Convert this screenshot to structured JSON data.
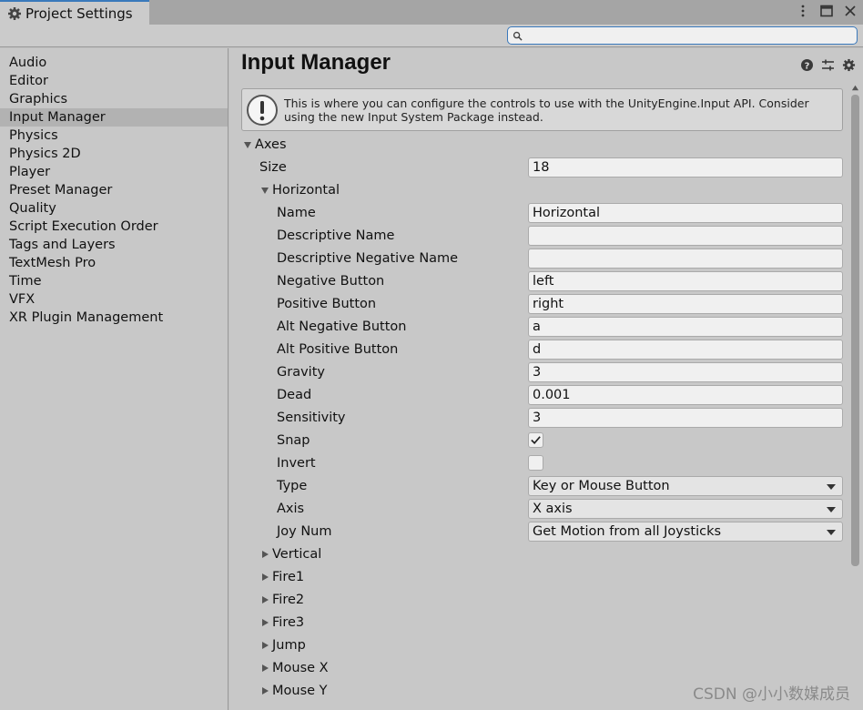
{
  "window": {
    "tab_label": "Project Settings",
    "tab_icon": "gear-icon",
    "controls": [
      "menu-dots-icon",
      "maximize-icon",
      "close-icon"
    ]
  },
  "search": {
    "placeholder": "",
    "value": ""
  },
  "sidebar": {
    "selected": "Input Manager",
    "items": [
      {
        "label": "Audio"
      },
      {
        "label": "Editor"
      },
      {
        "label": "Graphics"
      },
      {
        "label": "Input Manager"
      },
      {
        "label": "Physics"
      },
      {
        "label": "Physics 2D"
      },
      {
        "label": "Player"
      },
      {
        "label": "Preset Manager"
      },
      {
        "label": "Quality"
      },
      {
        "label": "Script Execution Order"
      },
      {
        "label": "Tags and Layers"
      },
      {
        "label": "TextMesh Pro"
      },
      {
        "label": "Time"
      },
      {
        "label": "VFX"
      },
      {
        "label": "XR Plugin Management"
      }
    ]
  },
  "main": {
    "title": "Input Manager",
    "header_icons": [
      "help-icon",
      "presets-icon",
      "settings-gear-icon"
    ],
    "help_text": "This is where you can configure the controls to use with the UnityEngine.Input API. Consider using the new Input System Package instead.",
    "axes_label": "Axes",
    "size_label": "Size",
    "size_value": "18",
    "horizontal_label": "Horizontal",
    "props": {
      "name": {
        "label": "Name",
        "value": "Horizontal"
      },
      "descriptive_name": {
        "label": "Descriptive Name",
        "value": ""
      },
      "descriptive_negative_name": {
        "label": "Descriptive Negative Name",
        "value": ""
      },
      "negative_button": {
        "label": "Negative Button",
        "value": "left"
      },
      "positive_button": {
        "label": "Positive Button",
        "value": "right"
      },
      "alt_negative_button": {
        "label": "Alt Negative Button",
        "value": "a"
      },
      "alt_positive_button": {
        "label": "Alt Positive Button",
        "value": "d"
      },
      "gravity": {
        "label": "Gravity",
        "value": "3"
      },
      "dead": {
        "label": "Dead",
        "value": "0.001"
      },
      "sensitivity": {
        "label": "Sensitivity",
        "value": "3"
      },
      "snap": {
        "label": "Snap",
        "checked": true
      },
      "invert": {
        "label": "Invert",
        "checked": false
      },
      "type": {
        "label": "Type",
        "value": "Key or Mouse Button"
      },
      "axis": {
        "label": "Axis",
        "value": "X axis"
      },
      "joy_num": {
        "label": "Joy Num",
        "value": "Get Motion from all Joysticks"
      }
    },
    "collapsed_axes": [
      "Vertical",
      "Fire1",
      "Fire2",
      "Fire3",
      "Jump",
      "Mouse X",
      "Mouse Y"
    ]
  },
  "watermark": "CSDN @小小数媒成员"
}
